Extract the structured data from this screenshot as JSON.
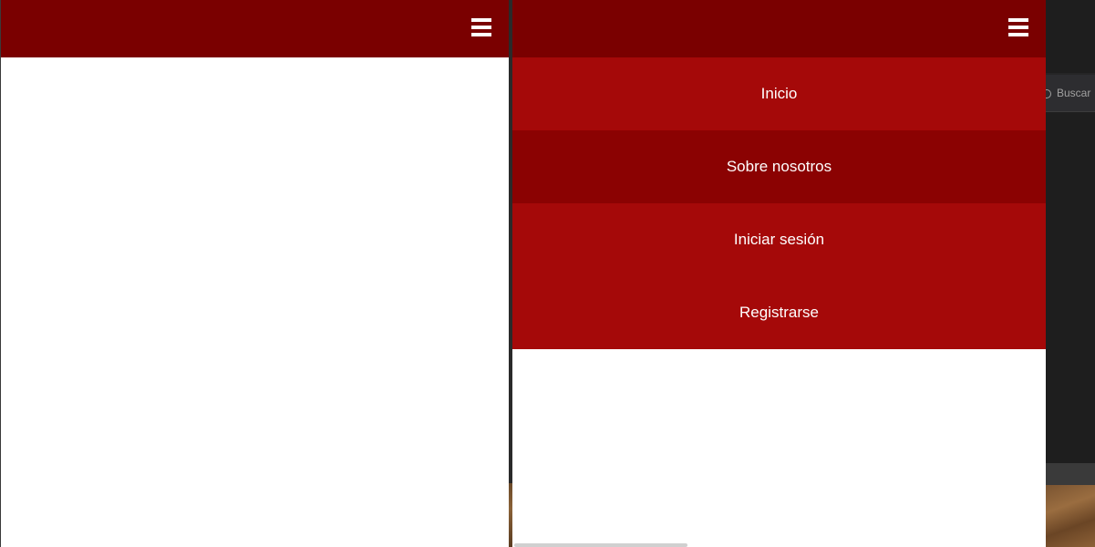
{
  "left_view": {
    "navbar": {
      "color": "#7a0000",
      "menu_icon": "hamburger-icon"
    }
  },
  "right_view": {
    "navbar": {
      "color": "#7a0000",
      "menu_icon": "hamburger-icon"
    },
    "menu": {
      "items": [
        {
          "label": "Inicio"
        },
        {
          "label": "Sobre nosotros"
        },
        {
          "label": "Iniciar sesión"
        },
        {
          "label": "Registrarse"
        }
      ],
      "item_color": "#a50909",
      "active_item_color": "#8b0202"
    }
  },
  "background_app": {
    "search_label": "Buscar"
  }
}
